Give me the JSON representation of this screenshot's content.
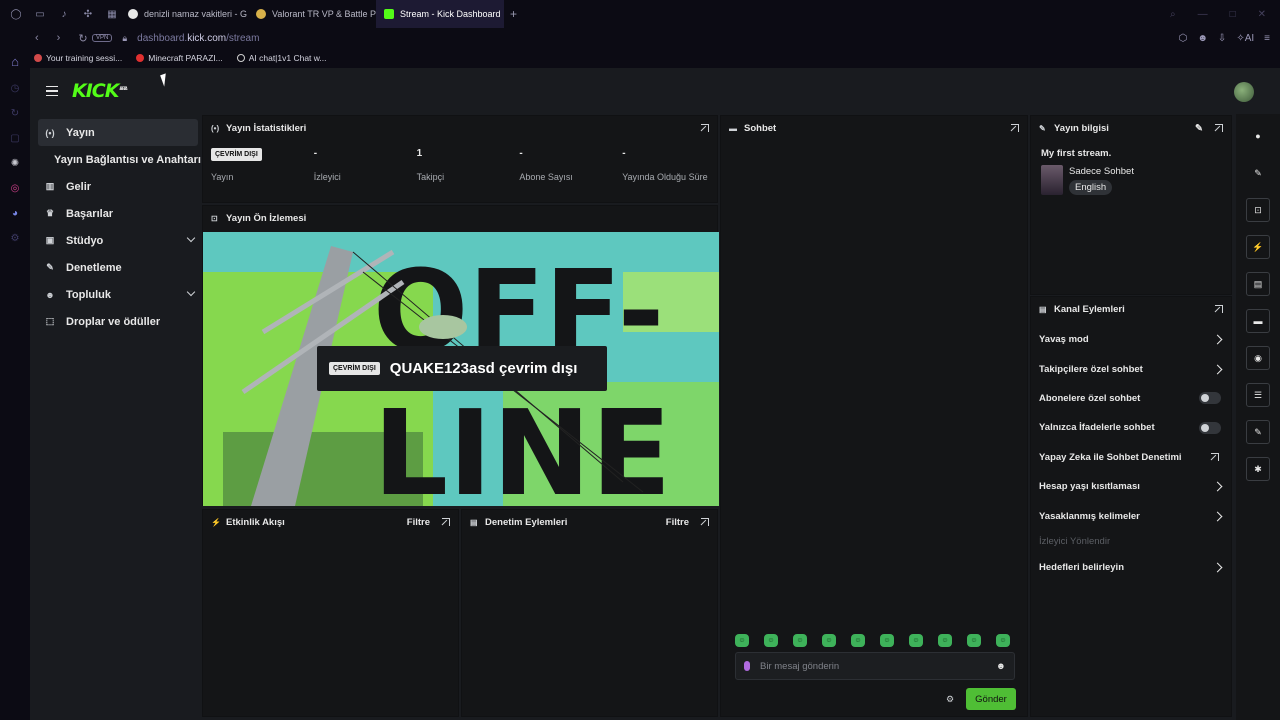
{
  "browser": {
    "tabs": [
      {
        "label": "denizli namaz vakitleri - G",
        "favicon_color": "#e8e8e8"
      },
      {
        "label": "Valorant TR VP & Battle Pa",
        "favicon_color": "#d8b14a"
      },
      {
        "label": "Stream - Kick Dashboard",
        "favicon_color": "#53fc18",
        "active": true
      }
    ],
    "new_tab": "+",
    "url_prefix": "dashboard.",
    "url_domain": "kick.com",
    "url_path": "/stream",
    "vpn": "VPN",
    "ai_label": "AI",
    "bookmarks": [
      {
        "label": "Your training sessi...",
        "color": "#d24a4a"
      },
      {
        "label": "Minecraft PARAZI...",
        "color": "#e03030"
      },
      {
        "label": "AI chat|1v1 Chat w...",
        "color": "#cfcfcf"
      }
    ]
  },
  "kick": {
    "logo": "KICK",
    "logo_badge": "BETA",
    "accent_color": "#53fc18"
  },
  "nav": {
    "items": [
      {
        "label": "Yayın",
        "icon": "broadcast-icon",
        "glyph": "(•)"
      },
      {
        "label": "Yayın Bağlantısı ve Anahtarı",
        "sub": true
      },
      {
        "label": "Gelir",
        "icon": "chart-icon",
        "glyph": "▥"
      },
      {
        "label": "Başarılar",
        "icon": "trophy-icon",
        "glyph": "♛"
      },
      {
        "label": "Stüdyo",
        "icon": "studio-icon",
        "glyph": "▣",
        "expandable": true
      },
      {
        "label": "Denetleme",
        "icon": "wrench-icon",
        "glyph": "✎"
      },
      {
        "label": "Topluluk",
        "icon": "users-icon",
        "glyph": "☻",
        "expandable": true
      },
      {
        "label": "Droplar ve ödüller",
        "icon": "drops-icon",
        "glyph": "⬚"
      }
    ]
  },
  "stats_panel": {
    "title": "Yayın İstatistikleri",
    "stats": [
      {
        "badge": "ÇEVRİM DIŞI",
        "label": "Yayın"
      },
      {
        "value": "-",
        "label": "İzleyici"
      },
      {
        "value": "1",
        "label": "Takipçi"
      },
      {
        "value": "-",
        "label": "Abone Sayısı"
      },
      {
        "value": "-",
        "label": "Yayında Olduğu Süre"
      }
    ]
  },
  "preview_panel": {
    "title": "Yayın Ön İzlemesi",
    "offline_badge": "ÇEVRİM DIŞI",
    "offline_text": "QUAKE123asd çevrim dışı",
    "art_text_top": "OFF-",
    "art_text_bottom": "LINE"
  },
  "activity_panel": {
    "title": "Etkinlik Akışı",
    "filter": "Filtre"
  },
  "mod_panel": {
    "title": "Denetim Eylemleri",
    "filter": "Filtre"
  },
  "chat_panel": {
    "title": "Sohbet",
    "placeholder": "Bir mesaj gönderin",
    "send": "Gönder",
    "emote_count": 10
  },
  "info_panel": {
    "title": "Yayın bilgisi",
    "stream_title": "My first stream.",
    "category": "Sadece Sohbet",
    "language": "English"
  },
  "actions_panel": {
    "title": "Kanal Eylemleri",
    "items": [
      {
        "label": "Yavaş mod",
        "kind": "arrow"
      },
      {
        "label": "Takipçilere özel sohbet",
        "kind": "arrow"
      },
      {
        "label": "Abonelere özel sohbet",
        "kind": "toggle"
      },
      {
        "label": "Yalnızca İfadelerle sohbet",
        "kind": "toggle"
      },
      {
        "label": "Yapay Zeka ile Sohbet Denetimi",
        "kind": "external"
      },
      {
        "label": "Hesap yaşı kısıtlaması",
        "kind": "arrow"
      },
      {
        "label": "Yasaklanmış kelimeler",
        "kind": "arrow"
      },
      {
        "label": "İzleyici Yönlendir",
        "kind": "dim"
      },
      {
        "label": "Hedefleri belirleyin",
        "kind": "arrow"
      }
    ]
  },
  "rail": [
    {
      "icon": "info-icon",
      "glyph": "●"
    },
    {
      "icon": "pencil-icon",
      "glyph": "✎"
    },
    {
      "icon": "focus-icon",
      "glyph": "⊡"
    },
    {
      "icon": "bolt-icon",
      "glyph": "⚡"
    },
    {
      "icon": "document-icon",
      "glyph": "▤"
    },
    {
      "icon": "chat-icon",
      "glyph": "▬"
    },
    {
      "icon": "broadcast-icon",
      "glyph": "◉"
    },
    {
      "icon": "layout-icon",
      "glyph": "☰"
    },
    {
      "icon": "wrench-icon",
      "glyph": "✎"
    },
    {
      "icon": "community-icon",
      "glyph": "✱"
    }
  ]
}
